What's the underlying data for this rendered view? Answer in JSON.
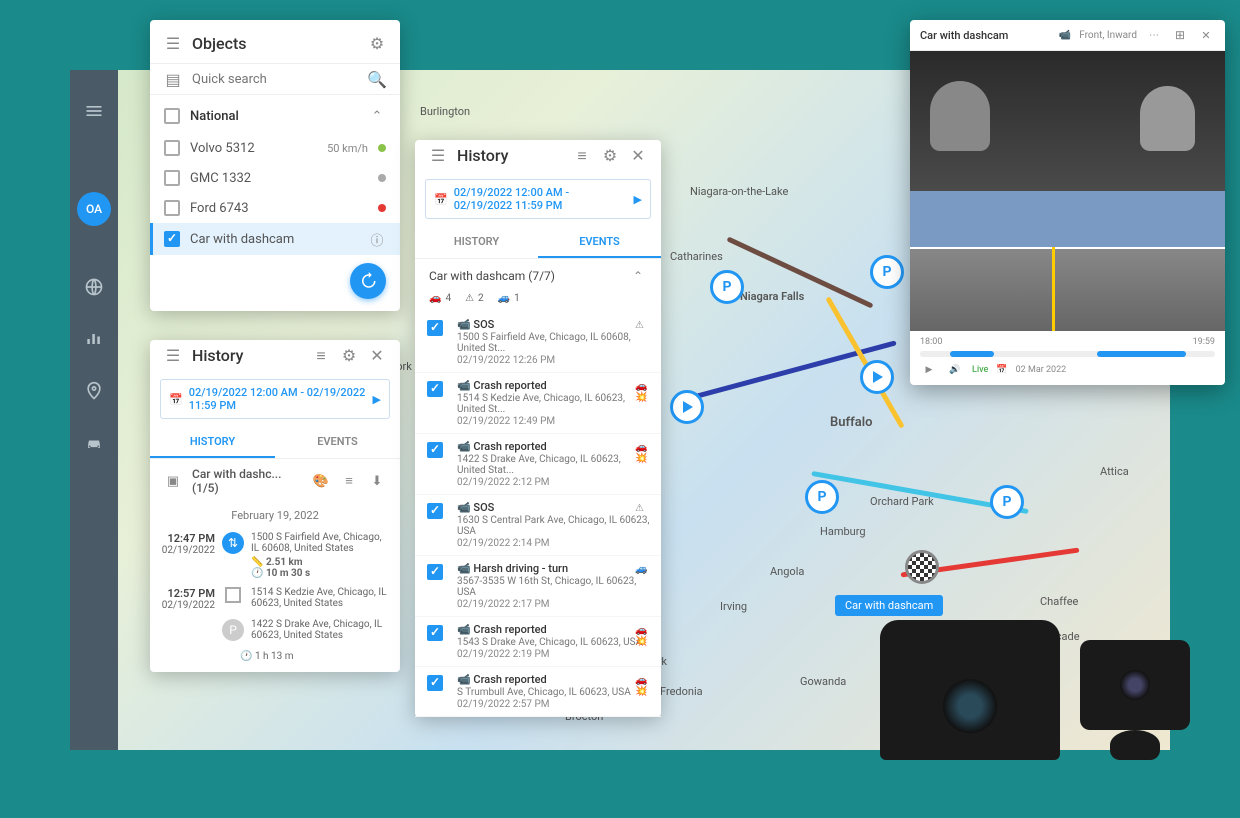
{
  "sidebar": {
    "avatar": "OA"
  },
  "objects": {
    "title": "Objects",
    "search_placeholder": "Quick search",
    "group_label": "National",
    "items": [
      {
        "name": "Volvo 5312",
        "speed": "50 km/h",
        "dot": "#8bc34a",
        "checked": false,
        "selected": false
      },
      {
        "name": "GMC 1332",
        "speed": "",
        "dot": "#aaaaaa",
        "checked": false,
        "selected": false
      },
      {
        "name": "Ford 6743",
        "speed": "",
        "dot": "#e53935",
        "checked": false,
        "selected": false
      },
      {
        "name": "Car with dashcam",
        "speed": "",
        "dot": "",
        "checked": true,
        "selected": true
      }
    ]
  },
  "history1": {
    "title": "History",
    "date_range": "02/19/2022 12:00 AM - 02/19/2022 11:59 PM",
    "tab_history": "HISTORY",
    "tab_events": "EVENTS",
    "selected_label": "Car with dashc...  (1/5)",
    "date_label": "February 19, 2022",
    "stops": [
      {
        "time": "12:47 PM",
        "date": "02/19/2022",
        "addr": "1500 S Fairfield Ave, Chicago, IL 60608, United States",
        "dist": "2.51 km",
        "dur": "10 m 30 s",
        "ball": "route"
      },
      {
        "time": "12:57 PM",
        "date": "02/19/2022",
        "addr": "1514 S Kedzie Ave, Chicago, IL 60623, United States",
        "ball": "stop"
      },
      {
        "time": "",
        "date": "",
        "addr": "1422 S Drake Ave, Chicago, IL 60623, United States",
        "ball": "P"
      }
    ],
    "total_duration": "1 h 13 m"
  },
  "history2": {
    "title": "History",
    "date_range": "02/19/2022 12:00 AM - 02/19/2022 11:59 PM",
    "tab_history": "HISTORY",
    "tab_events": "EVENTS",
    "summary_label": "Car with dashcam  (7/7)",
    "counts": {
      "crash": "4",
      "alert": "2",
      "drive": "1"
    },
    "events": [
      {
        "title": "SOS",
        "addr": "1500 S Fairfield Ave, Chicago, IL 60608, United St...",
        "time": "02/19/2022 12:26 PM",
        "icon": "alert"
      },
      {
        "title": "Crash reported",
        "addr": "1514 S Kedzie Ave, Chicago, IL 60623, United St...",
        "time": "02/19/2022 12:49 PM",
        "icon": "crash"
      },
      {
        "title": "Crash reported",
        "addr": "1422 S Drake Ave, Chicago, IL 60623, United Stat...",
        "time": "02/19/2022 2:12 PM",
        "icon": "crash"
      },
      {
        "title": "SOS",
        "addr": "1630 S Central Park Ave, Chicago, IL 60623, USA",
        "time": "02/19/2022 2:14 PM",
        "icon": "alert"
      },
      {
        "title": "Harsh driving - turn",
        "addr": "3567-3535 W 16th St, Chicago, IL 60623, USA",
        "time": "02/19/2022 2:17 PM",
        "icon": "car"
      },
      {
        "title": "Crash reported",
        "addr": "1543 S Drake Ave, Chicago, IL 60623, USA",
        "time": "02/19/2022 2:19 PM",
        "icon": "crash"
      },
      {
        "title": "Crash reported",
        "addr": "S Trumbull Ave, Chicago, IL 60623, USA",
        "time": "02/19/2022 2:57 PM",
        "icon": "crash"
      }
    ]
  },
  "video": {
    "title": "Car with dashcam",
    "source": "Front, Inward",
    "tl_start": "18:00",
    "tl_end": "19:59",
    "live_label": "Live",
    "date": "02 Mar 2022"
  },
  "map": {
    "tooltip": "Car with dashcam",
    "labels": [
      "Burlington",
      "Niagara-on-the-Lake",
      "Niagara Falls",
      "Buffalo",
      "Orchard Park",
      "Hamburg",
      "Angola",
      "Irving",
      "Dunkirk",
      "Fredonia",
      "Gowanda",
      "Chaffee",
      "Arcade",
      "Attica",
      "York",
      "Brocton",
      "Catharines"
    ]
  }
}
